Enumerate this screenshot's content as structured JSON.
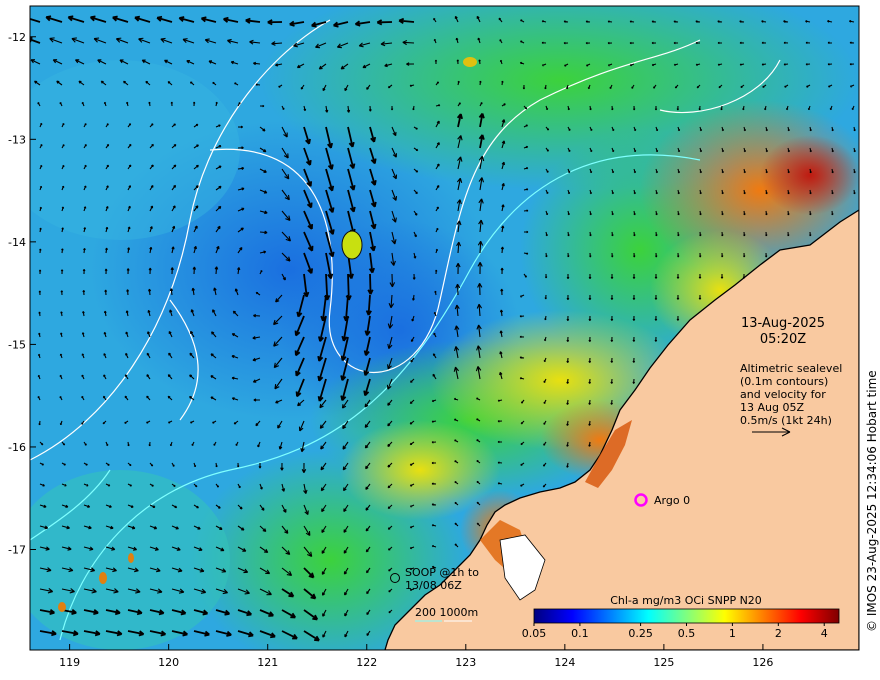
{
  "map": {
    "lon_ticks": [
      "119",
      "120",
      "121",
      "122",
      "123",
      "124",
      "125",
      "126"
    ],
    "lat_ticks": [
      "-12",
      "-13",
      "-14",
      "-15",
      "-16",
      "-17"
    ],
    "lon_range": [
      118.6,
      126.97
    ],
    "lat_range": [
      -17.98,
      -11.7
    ]
  },
  "annotations": {
    "date": "13-Aug-2025",
    "time": "05:20Z",
    "legend_lines": [
      "Altimetric sealevel",
      "(0.1m contours)",
      "and velocity for",
      "13 Aug 05Z",
      "0.5m/s (1kt 24h)"
    ],
    "argo_label": "Argo 0",
    "soop_lines": [
      "SOOP @1h to",
      "13/08 06Z"
    ],
    "depth_legend": "200  1000m",
    "copyright": "© IMOS 23-Aug-2025 12:34:06 Hobart time"
  },
  "colorbar": {
    "title": "Chl-a mg/m3 OCi SNPP N20",
    "ticks": [
      "0.05",
      "0.1",
      "0.25",
      "0.5",
      "1",
      "2",
      "4"
    ],
    "tick_values": [
      0.05,
      0.1,
      0.25,
      0.5,
      1,
      2,
      4
    ],
    "range": [
      0.05,
      5
    ],
    "scale": "log",
    "colors": [
      "#00007f",
      "#0000ff",
      "#007fff",
      "#00ffff",
      "#7fff7f",
      "#ffff00",
      "#ff7f00",
      "#ff0000",
      "#7f0000"
    ]
  },
  "colors": {
    "land": "#f9c9a0",
    "coast": "#000000",
    "argo_marker": "#ff00ff",
    "contour_white": "#ffffff",
    "contour_cyan": "#7fffff",
    "vector": "#000000"
  }
}
